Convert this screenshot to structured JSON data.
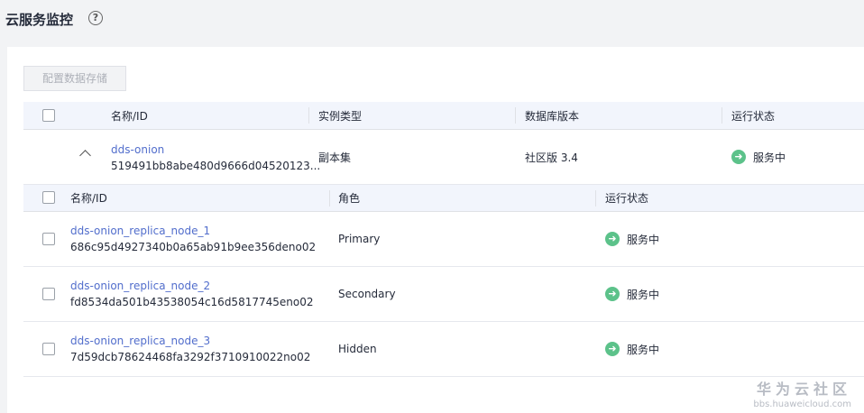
{
  "header": {
    "title": "云服务监控",
    "help_glyph": "?"
  },
  "toolbar": {
    "config_storage_label": "配置数据存储"
  },
  "main_table": {
    "columns": [
      "名称/ID",
      "实例类型",
      "数据库版本",
      "运行状态"
    ],
    "rows": [
      {
        "name": "dds-onion",
        "id": "519491bb8abe480d9666d04520123...",
        "type": "副本集",
        "version": "社区版 3.4",
        "status": "服务中"
      }
    ]
  },
  "sub_table": {
    "columns": [
      "名称/ID",
      "角色",
      "运行状态"
    ],
    "rows": [
      {
        "name": "dds-onion_replica_node_1",
        "id": "686c95d4927340b0a65ab91b9ee356deno02",
        "role": "Primary",
        "status": "服务中"
      },
      {
        "name": "dds-onion_replica_node_2",
        "id": "fd8534da501b43538054c16d5817745eno02",
        "role": "Secondary",
        "status": "服务中"
      },
      {
        "name": "dds-onion_replica_node_3",
        "id": "7d59dcb78624468fa3292f3710910022no02",
        "role": "Hidden",
        "status": "服务中"
      }
    ]
  },
  "watermark": {
    "main": "华为云社区",
    "sub": "bbs.huaweicloud.com"
  },
  "colors": {
    "link": "#526ecc",
    "status_running": "#5cc28a",
    "header_bg": "#f2f5fc"
  }
}
